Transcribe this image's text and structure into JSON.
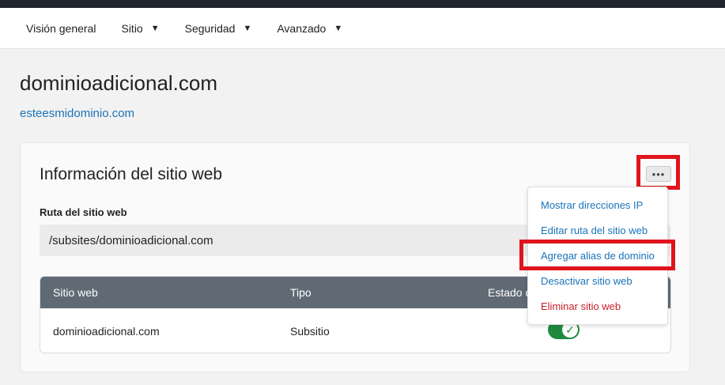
{
  "nav": {
    "items": [
      {
        "label": "Visión general",
        "dropdown": false
      },
      {
        "label": "Sitio",
        "dropdown": true
      },
      {
        "label": "Seguridad",
        "dropdown": true
      },
      {
        "label": "Avanzado",
        "dropdown": true
      }
    ],
    "caret": "▼"
  },
  "page": {
    "title": "dominioadicional.com",
    "alias_link": "esteesmidominio.com"
  },
  "card": {
    "title": "Información del sitio web",
    "more_button": "•••",
    "path_label": "Ruta del sitio web",
    "path_value": "/subsites/dominioadicional.com"
  },
  "table": {
    "headers": [
      "Sitio web",
      "Tipo",
      "Estado d"
    ],
    "rows": [
      {
        "site": "dominioadicional.com",
        "type": "Subsitio",
        "enabled": true,
        "check": "✓"
      }
    ]
  },
  "menu": {
    "items": [
      {
        "label": "Mostrar direcciones IP",
        "danger": false
      },
      {
        "label": "Editar ruta del sitio web",
        "danger": false
      },
      {
        "label": "Agregar alias de dominio",
        "danger": false
      },
      {
        "label": "Desactivar sitio web",
        "danger": false
      },
      {
        "label": "Eliminar sitio web",
        "danger": true
      }
    ]
  },
  "colors": {
    "link": "#1a73b8",
    "danger": "#c81e2a",
    "highlight": "#e0141c",
    "toggle_on": "#1e8a3e",
    "table_header": "#5f6a74",
    "topbar": "#1f262d"
  }
}
